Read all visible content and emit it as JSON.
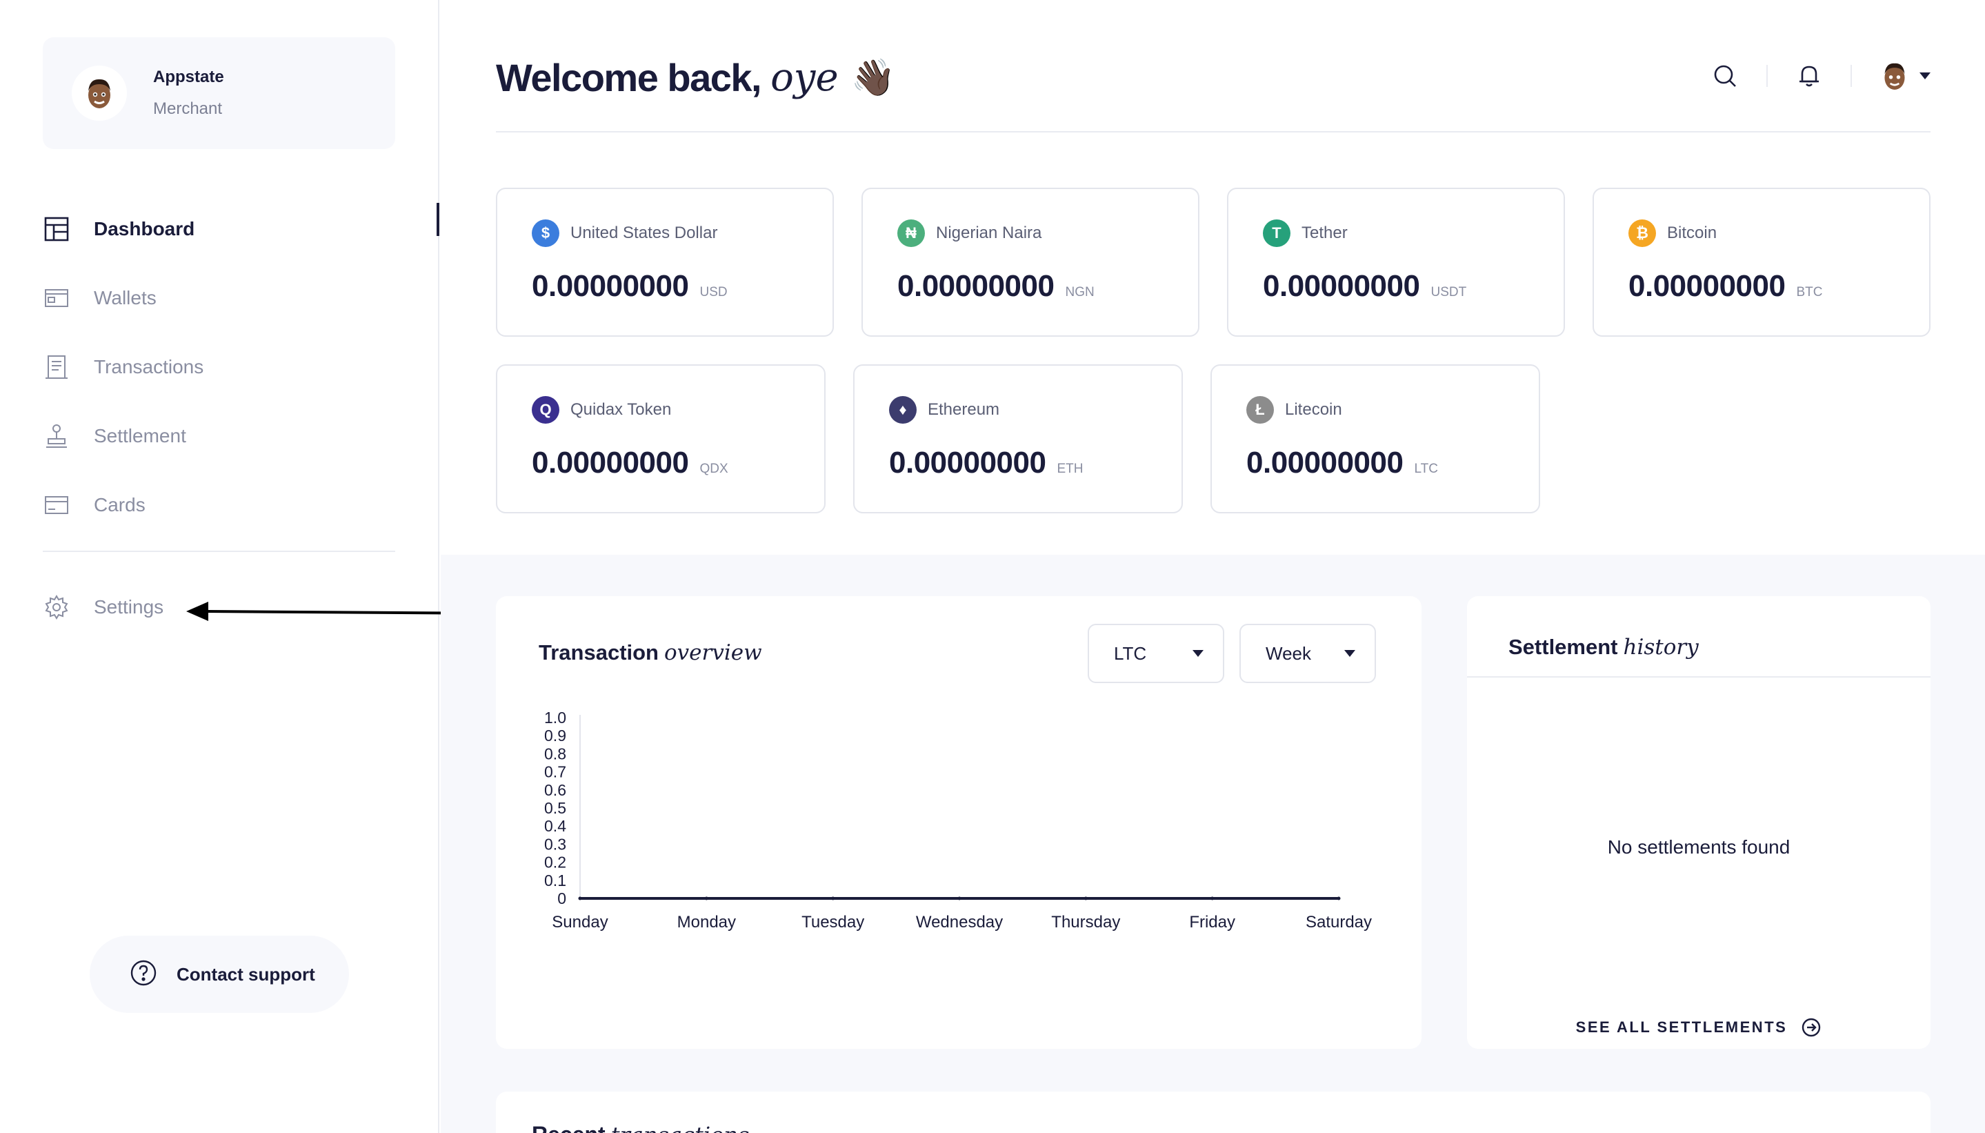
{
  "profile": {
    "name": "Appstate",
    "role": "Merchant"
  },
  "nav": {
    "items": [
      {
        "label": "Dashboard",
        "icon": "dashboard-icon",
        "active": true
      },
      {
        "label": "Wallets",
        "icon": "wallet-icon",
        "active": false
      },
      {
        "label": "Transactions",
        "icon": "receipt-icon",
        "active": false
      },
      {
        "label": "Settlement",
        "icon": "stamp-icon",
        "active": false
      },
      {
        "label": "Cards",
        "icon": "card-icon",
        "active": false
      }
    ],
    "settings_label": "Settings"
  },
  "support": {
    "label": "Contact support"
  },
  "header": {
    "welcome": "Welcome back,",
    "name": "oye",
    "wave": "👋🏿"
  },
  "balances": [
    {
      "name": "United States Dollar",
      "amount": "0.00000000",
      "code": "USD",
      "color": "#3b7ddd",
      "glyph": "$"
    },
    {
      "name": "Nigerian Naira",
      "amount": "0.00000000",
      "code": "NGN",
      "color": "#4caf7d",
      "glyph": "₦"
    },
    {
      "name": "Tether",
      "amount": "0.00000000",
      "code": "USDT",
      "color": "#26a17b",
      "glyph": "T"
    },
    {
      "name": "Bitcoin",
      "amount": "0.00000000",
      "code": "BTC",
      "color": "#f5a623",
      "glyph": "₿"
    },
    {
      "name": "Quidax Token",
      "amount": "0.00000000",
      "code": "QDX",
      "color": "#3a2f8f",
      "glyph": "Q"
    },
    {
      "name": "Ethereum",
      "amount": "0.00000000",
      "code": "ETH",
      "color": "#3c3c6e",
      "glyph": "♦"
    },
    {
      "name": "Litecoin",
      "amount": "0.00000000",
      "code": "LTC",
      "color": "#8c8c8c",
      "glyph": "Ł"
    }
  ],
  "overview": {
    "title": "Transaction",
    "title_italic": "overview",
    "currency_value": "LTC",
    "period_value": "Week"
  },
  "settlement": {
    "title": "Settlement",
    "title_italic": "history",
    "empty": "No settlements found",
    "see_all": "SEE ALL SETTLEMENTS"
  },
  "recent": {
    "title": "Recent",
    "title_italic": "transactions"
  },
  "chart_data": {
    "type": "line",
    "categories": [
      "Sunday",
      "Monday",
      "Tuesday",
      "Wednesday",
      "Thursday",
      "Friday",
      "Saturday"
    ],
    "series": [
      {
        "values": [
          0,
          0,
          0,
          0,
          0,
          0,
          0
        ]
      }
    ],
    "yticks": [
      "1.0",
      "0.9",
      "0.8",
      "0.7",
      "0.6",
      "0.5",
      "0.4",
      "0.3",
      "0.2",
      "0.1",
      "0"
    ],
    "ylim": [
      0,
      1
    ],
    "grid": false
  }
}
